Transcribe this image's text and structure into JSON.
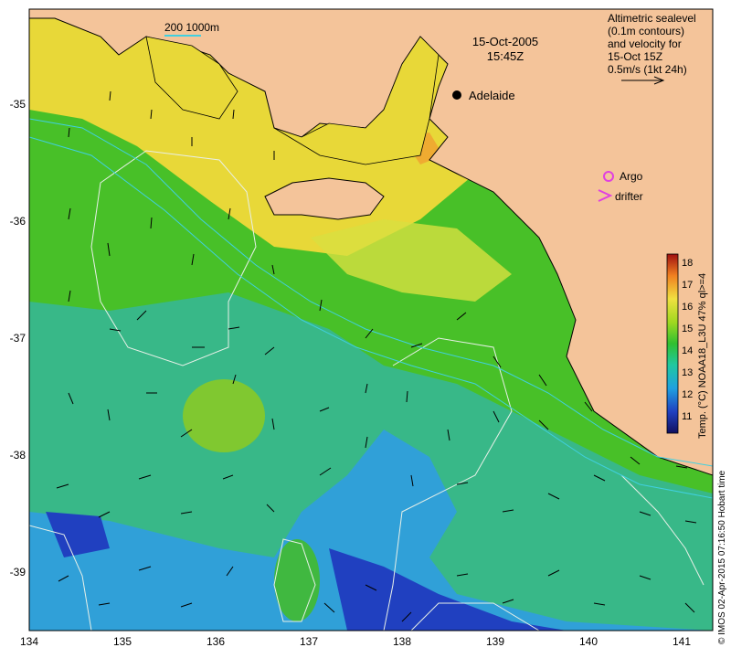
{
  "map": {
    "date": "15-Oct-2005",
    "time": "15:45Z",
    "scale_text": "200  1000m",
    "place_label": "Adelaide",
    "info_lines": [
      "Altimetric sealevel",
      "(0.1m contours)",
      "and velocity for",
      "15-Oct 15Z",
      "0.5m/s (1kt 24h)"
    ],
    "legend": {
      "argo_label": "Argo",
      "drifter_label": "drifter",
      "argo_color": "#e040e0",
      "drifter_color": "#e040e0"
    },
    "colorbar": {
      "label": "Temp. (°C) NOAA18_L3U 47% ql>=4",
      "ticks": [
        "11",
        "12",
        "13",
        "14",
        "15",
        "16",
        "17",
        "18"
      ]
    },
    "credit": "© IMOS 02-Apr-2015 07:16:50 Hobart time",
    "x_ticks": [
      "134",
      "135",
      "136",
      "137",
      "138",
      "139",
      "140",
      "141"
    ],
    "y_ticks": [
      "-35",
      "-36",
      "-37",
      "-38",
      "-39"
    ],
    "colors": {
      "land": "#f4c49a",
      "warm": "#f0d840",
      "mid": "#48c828",
      "cool": "#28b8a0",
      "cold": "#2850d0"
    }
  }
}
